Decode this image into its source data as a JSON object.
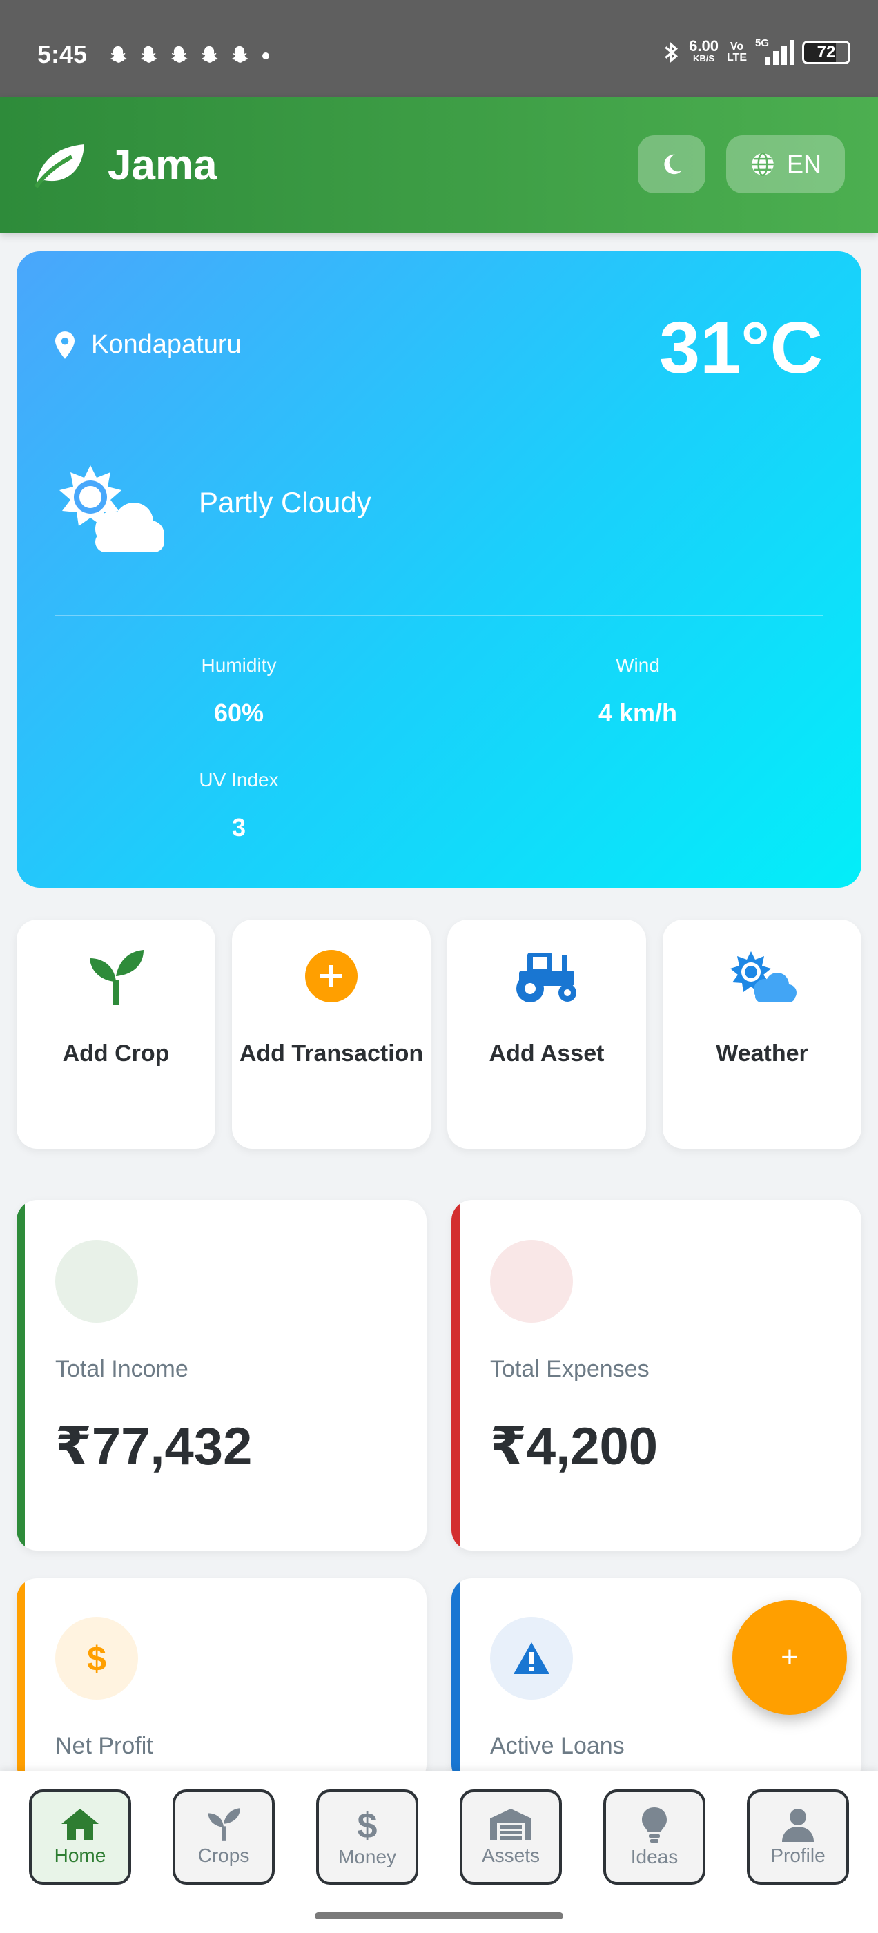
{
  "status_bar": {
    "time": "5:45",
    "net_speed": "6.00",
    "net_unit": "KB/S",
    "volte_top": "Vo",
    "volte_bottom": "LTE",
    "network": "5G",
    "battery": "72"
  },
  "header": {
    "app_name": "Jama",
    "language": "EN"
  },
  "weather": {
    "location": "Kondapaturu",
    "temperature": "31°C",
    "condition": "Partly Cloudy",
    "humidity_label": "Humidity",
    "humidity": "60%",
    "wind_label": "Wind",
    "wind": "4 km/h",
    "uv_label": "UV Index",
    "uv": "3"
  },
  "quick_actions": [
    {
      "label": "Add Crop",
      "icon": "sprout-icon"
    },
    {
      "label": "Add Transaction",
      "icon": "plus-circle-icon"
    },
    {
      "label": "Add Asset",
      "icon": "tractor-icon"
    },
    {
      "label": "Weather",
      "icon": "cloud-sun-icon"
    }
  ],
  "stats": {
    "income": {
      "label": "Total Income",
      "value": "₹77,432",
      "color": "#2e8b3a"
    },
    "expenses": {
      "label": "Total Expenses",
      "value": "₹4,200",
      "color": "#d32f2f"
    },
    "profit": {
      "label": "Net Profit",
      "color": "#ff9f00"
    },
    "loans": {
      "label": "Active Loans",
      "color": "#1976d2"
    }
  },
  "fab": {
    "symbol": "+"
  },
  "nav": {
    "home": "Home",
    "crops": "Crops",
    "money": "Money",
    "assets": "Assets",
    "ideas": "Ideas",
    "profile": "Profile"
  },
  "colors": {
    "brand": "#3a9c40",
    "accent": "#ff9f00",
    "weather_start": "#4aa6fb",
    "weather_end": "#03eef9"
  }
}
